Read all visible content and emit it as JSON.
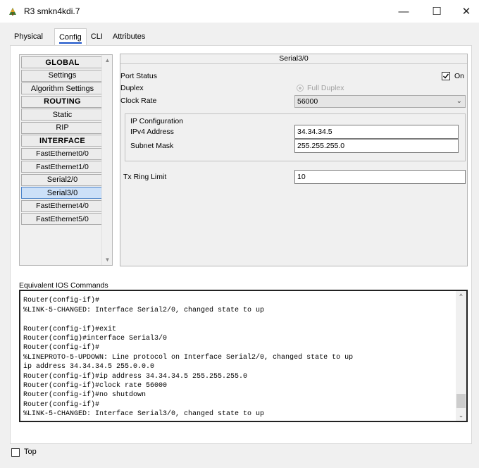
{
  "window": {
    "title": "R3 smkn4kdi.7",
    "min_glyph": "—",
    "max_glyph": "☐",
    "close_glyph": "✕"
  },
  "tabs": [
    {
      "label": "Physical"
    },
    {
      "label": "Config"
    },
    {
      "label": "CLI"
    },
    {
      "label": "Attributes"
    }
  ],
  "sidebar": {
    "items": [
      {
        "label": "GLOBAL",
        "kind": "header"
      },
      {
        "label": "Settings"
      },
      {
        "label": "Algorithm Settings"
      },
      {
        "label": "ROUTING",
        "kind": "header"
      },
      {
        "label": "Static"
      },
      {
        "label": "RIP"
      },
      {
        "label": "INTERFACE",
        "kind": "header"
      },
      {
        "label": "FastEthernet0/0"
      },
      {
        "label": "FastEthernet1/0"
      },
      {
        "label": "Serial2/0"
      },
      {
        "label": "Serial3/0",
        "selected": true
      },
      {
        "label": "FastEthernet4/0"
      },
      {
        "label": "FastEthernet5/0"
      }
    ]
  },
  "config": {
    "header": "Serial3/0",
    "port_status_label": "Port Status",
    "port_on_label": "On",
    "duplex_label": "Duplex",
    "duplex_value": "Full Duplex",
    "clock_rate_label": "Clock Rate",
    "clock_rate_value": "56000",
    "ip_config_label": "IP Configuration",
    "ipv4_label": "IPv4 Address",
    "ipv4_value": "34.34.34.5",
    "subnet_label": "Subnet Mask",
    "subnet_value": "255.255.255.0",
    "tx_ring_label": "Tx Ring Limit",
    "tx_ring_value": "10"
  },
  "console": {
    "label": "Equivalent IOS Commands",
    "lines": [
      "Router(config-if)#",
      "%LINK-5-CHANGED: Interface Serial2/0, changed state to up",
      "",
      "Router(config-if)#exit",
      "Router(config)#interface Serial3/0",
      "Router(config-if)#",
      "%LINEPROTO-5-UPDOWN: Line protocol on Interface Serial2/0, changed state to up",
      "ip address 34.34.34.5 255.0.0.0",
      "Router(config-if)#ip address 34.34.34.5 255.255.255.0",
      "Router(config-if)#clock rate 56000",
      "Router(config-if)#no shutdown",
      "Router(config-if)#",
      "%LINK-5-CHANGED: Interface Serial3/0, changed state to up"
    ]
  },
  "footer": {
    "top_label": "Top"
  },
  "colors": {
    "accent": "#1b53c8",
    "selected_bg": "#cce0f8"
  }
}
